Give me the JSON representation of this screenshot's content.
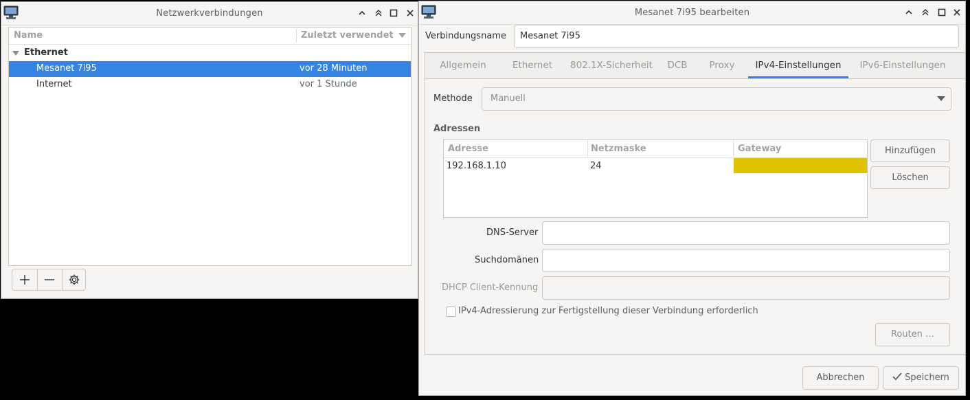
{
  "left_window": {
    "title": "Netzwerkverbindungen",
    "columns": {
      "name": "Name",
      "last_used": "Zuletzt verwendet"
    },
    "group": "Ethernet",
    "connections": [
      {
        "name": "Mesanet 7i95",
        "last_used": "vor 28 Minuten"
      },
      {
        "name": "Internet",
        "last_used": "vor 1 Stunde"
      }
    ],
    "toolbar": {
      "add": "add-icon",
      "remove": "remove-icon",
      "settings": "gear-icon"
    }
  },
  "right_window": {
    "title": "Mesanet 7i95 bearbeiten",
    "connection_name_label": "Verbindungsname",
    "connection_name_value": "Mesanet 7i95",
    "tabs": [
      "Allgemein",
      "Ethernet",
      "802.1X-Sicherheit",
      "DCB",
      "Proxy",
      "IPv4-Einstellungen",
      "IPv6-Einstellungen"
    ],
    "active_tab": "IPv4-Einstellungen",
    "method_label": "Methode",
    "method_value": "Manuell",
    "addresses_label": "Adressen",
    "address_columns": [
      "Adresse",
      "Netzmaske",
      "Gateway"
    ],
    "addresses": [
      {
        "address": "192.168.1.10",
        "netmask": "24",
        "gateway": ""
      }
    ],
    "add_button": "Hinzufügen",
    "delete_button": "Löschen",
    "dns_label": "DNS-Server",
    "dns_value": "",
    "search_domains_label": "Suchdomänen",
    "search_domains_value": "",
    "dhcp_client_id_label": "DHCP Client-Kennung",
    "dhcp_client_id_value": "",
    "require_ipv4_label": "IPv4-Adressierung zur Fertigstellung dieser Verbindung erforderlich",
    "require_ipv4_checked": false,
    "routes_button": "Routen …",
    "cancel_button": "Abbrechen",
    "save_button": "Speichern"
  },
  "colors": {
    "accent": "#3584e4",
    "gateway_highlight": "#dfc300",
    "background": "#000000"
  }
}
